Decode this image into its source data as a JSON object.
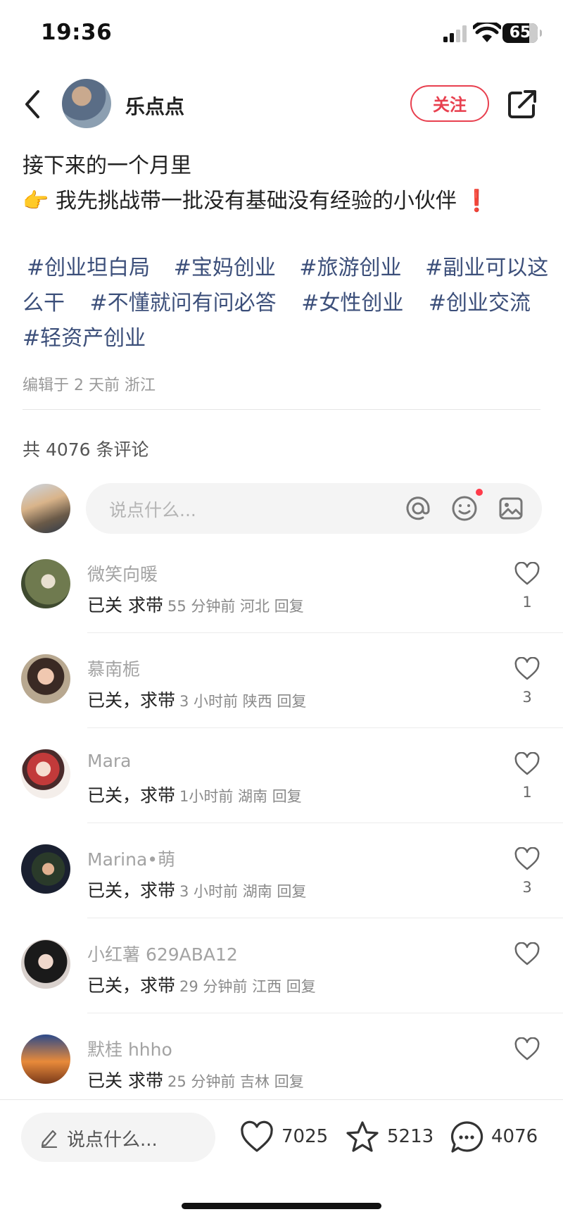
{
  "status_bar": {
    "time": "19:36",
    "battery": "65"
  },
  "header": {
    "author_name": "乐点点",
    "follow_label": "关注"
  },
  "post": {
    "line1": "接下来的一个月里",
    "line2_emoji": "👉",
    "line2_text": "我先挑战带一批没有基础没有经验的小伙伴",
    "line2_end": "❗",
    "tags_line1": [
      "#创业坦白局",
      "#宝妈创业",
      "#旅游创业",
      "#副业可以这"
    ],
    "tags_line2": [
      "么干",
      "#不懂就问有问必答",
      "#女性创业",
      "#创业交流"
    ],
    "tags_line3": [
      "#轻资产创业"
    ],
    "meta": "编辑于 2 天前 浙江"
  },
  "comments_section": {
    "count_label": "共 4076 条评论",
    "input_placeholder": "说点什么..."
  },
  "comments": [
    {
      "name": "微笑向暖",
      "text": "已关 求带",
      "meta": "55 分钟前 河北 回复",
      "likes": "1"
    },
    {
      "name": "慕南栀",
      "text": "已关，求带",
      "meta": "3 小时前 陕西 回复",
      "likes": "3"
    },
    {
      "name": "Mara",
      "text": "已关，求带",
      "meta": "1小时前 湖南 回复",
      "likes": "1"
    },
    {
      "name": "Marina•萌",
      "text": "已关，求带",
      "meta": "3 小时前 湖南 回复",
      "likes": "3"
    },
    {
      "name": "小红薯 629ABA12",
      "text": "已关，求带",
      "meta": "29 分钟前 江西 回复",
      "likes": ""
    },
    {
      "name": "默桂 hhho",
      "text": "已关 求带",
      "meta": "25 分钟前 吉林 回复",
      "likes": ""
    }
  ],
  "bottom_bar": {
    "placeholder": "说点什么...",
    "likes": "7025",
    "collects": "5213",
    "comments": "4076"
  },
  "colors": {
    "accent_red": "#e8404f",
    "tag_blue": "#3c4f7a"
  }
}
